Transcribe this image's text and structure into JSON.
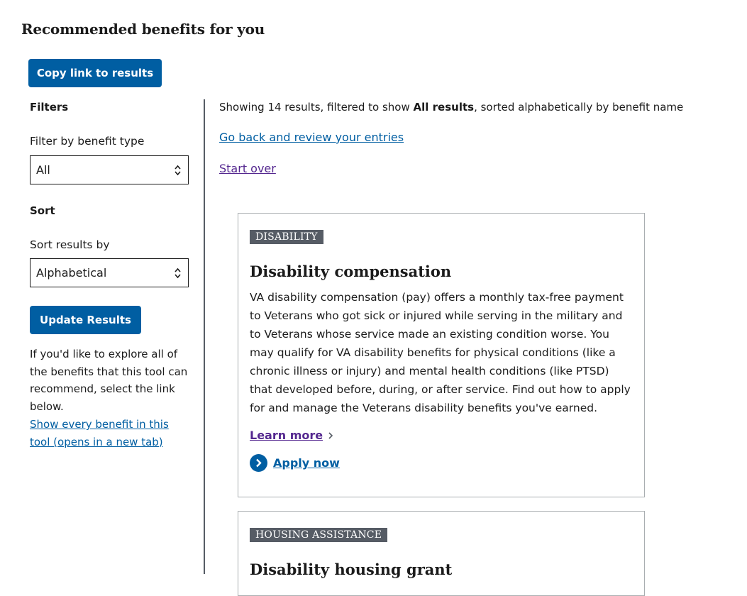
{
  "page": {
    "title": "Recommended benefits for you"
  },
  "actions": {
    "copy_link_label": "Copy link to results"
  },
  "filters": {
    "heading": "Filters",
    "benefit_type_label": "Filter by benefit type",
    "benefit_type_value": "All",
    "sort_heading": "Sort",
    "sort_label": "Sort results by",
    "sort_value": "Alphabetical",
    "update_label": "Update Results",
    "explore_text": "If you'd like to explore all of the benefits that this tool can recommend, select the link below.",
    "show_all_link": "Show every benefit in this tool (opens in a new tab)"
  },
  "results": {
    "summary_prefix": "Showing 14 results, filtered to show ",
    "summary_bold": "All results",
    "summary_suffix": ", sorted alphabetically by benefit name",
    "go_back_link": "Go back and review your entries",
    "start_over_link": "Start over"
  },
  "cards": [
    {
      "tag": "DISABILITY",
      "title": "Disability compensation",
      "description": "VA disability compensation (pay) offers a monthly tax-free payment to Veterans who got sick or injured while serving in the military and to Veterans whose service made an existing condition worse. You may qualify for VA disability benefits for physical conditions (like a chronic illness or injury) and mental health conditions (like PTSD) that developed before, during, or after service. Find out how to apply for and manage the Veterans disability benefits you've earned.",
      "learn_more": "Learn more",
      "apply_now": "Apply now"
    },
    {
      "tag": "HOUSING ASSISTANCE",
      "title": "Disability housing grant"
    }
  ],
  "colors": {
    "primary": "#005ea2",
    "visited": "#54278f",
    "tag_bg": "#565c65",
    "border": "#a9aeb1"
  }
}
